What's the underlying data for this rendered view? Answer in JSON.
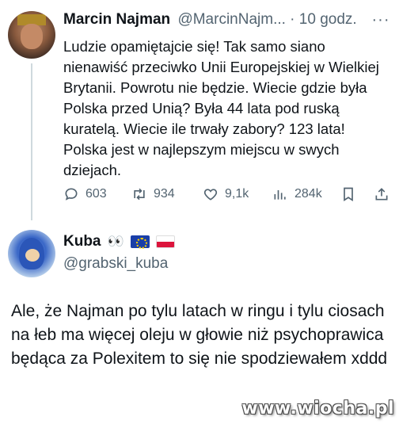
{
  "tweet1": {
    "author_name": "Marcin Najman",
    "handle_time": "@MarcinNajm... · 10 godz.",
    "more_label": "···",
    "text": "Ludzie opamiętajcie się! Tak samo siano nienawiść przeciwko Unii Europejskiej w Wielkiej Brytanii. Powrotu nie będzie. Wiecie gdzie była Polska przed Unią? Była 44 lata pod ruską kuratelą. Wiecie ile trwały zabory? 123 lata! Polska jest w najlepszym miejscu w swych dziejach.",
    "actions": {
      "replies": "603",
      "retweets": "934",
      "likes": "9,1k",
      "views": "284k"
    }
  },
  "tweet2": {
    "author_name": "Kuba",
    "name_emoji": "👀",
    "handle": "@grabski_kuba",
    "text": "Ale, że Najman po tylu latach w ringu i tylu ciosach na łeb ma więcej oleju w głowie niż psychoprawica będąca za Polexitem to się nie spodziewałem xddd"
  },
  "watermark": "www.wiocha.pl",
  "icons": {
    "reply": "reply-icon",
    "retweet": "retweet-icon",
    "like": "heart-icon",
    "views": "views-icon",
    "bookmark": "bookmark-icon",
    "share": "share-icon"
  },
  "colors": {
    "text": "#0f1419",
    "secondary": "#536471",
    "thread_line": "#cfd9de"
  }
}
